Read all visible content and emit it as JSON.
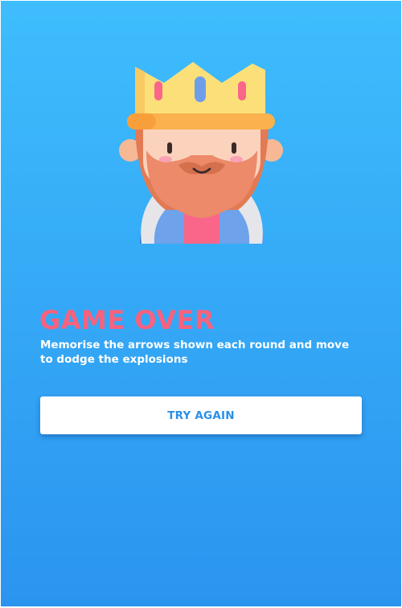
{
  "game_over": {
    "title": "GAME OVER",
    "message": "Memorise the arrows shown each round and move to dodge the explosions",
    "retry_label": "TRY AGAIN"
  },
  "character": {
    "icon": "king-icon"
  },
  "colors": {
    "background_top": "#3ebdfd",
    "background_bottom": "#2b94ef",
    "title": "#f7627e",
    "button_text": "#2b8fe8",
    "button_bg": "#ffffff"
  }
}
